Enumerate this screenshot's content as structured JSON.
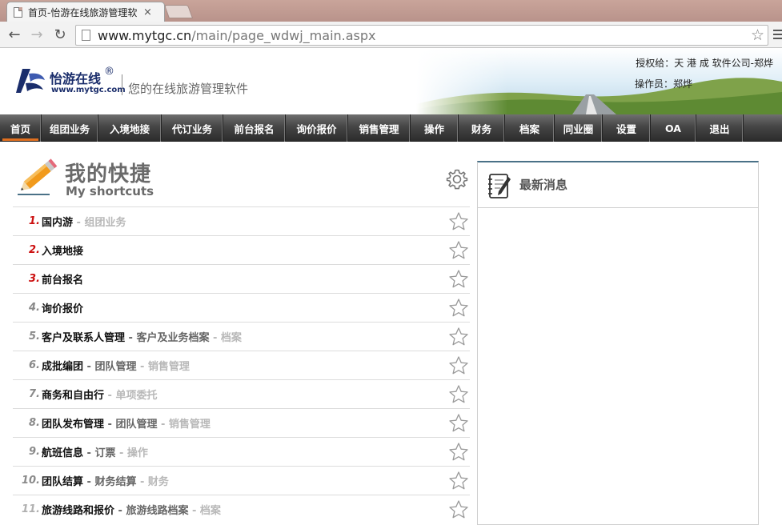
{
  "browser": {
    "tab_title": "首页-怡游在线旅游管理软",
    "tab_close": "×",
    "url_host": "www.mytgc.cn",
    "url_path": "/main/page_wdwj_main.aspx"
  },
  "header": {
    "brand_name": "怡游在线",
    "brand_reg": "®",
    "brand_url": "www.mytgc.com",
    "slogan": "您的在线旅游管理软件",
    "authorized_to": "授权给：天 港 成 软件公司-郑烨",
    "operator": "操作员：郑烨"
  },
  "nav": {
    "items": [
      {
        "label": "首页",
        "active": true
      },
      {
        "label": "组团业务"
      },
      {
        "label": "入境地接"
      },
      {
        "label": "代订业务"
      },
      {
        "label": "前台报名"
      },
      {
        "label": "询价报价"
      },
      {
        "label": "销售管理"
      },
      {
        "label": "操作"
      },
      {
        "label": "财务"
      },
      {
        "label": "档案"
      },
      {
        "label": "同业圈"
      },
      {
        "label": "设置"
      },
      {
        "label": "OA"
      },
      {
        "label": "退出"
      }
    ]
  },
  "shortcuts": {
    "title_cn": "我的快捷",
    "title_en": "My shortcuts",
    "items": [
      {
        "num": "1.",
        "num_color": "red",
        "main": "国内游",
        "mid": "",
        "tail": " - 组团业务"
      },
      {
        "num": "2.",
        "num_color": "red",
        "main": "入境地接",
        "mid": "",
        "tail": ""
      },
      {
        "num": "3.",
        "num_color": "red",
        "main": "前台报名",
        "mid": "",
        "tail": ""
      },
      {
        "num": "4.",
        "num_color": "grey",
        "main": "询价报价",
        "mid": "",
        "tail": ""
      },
      {
        "num": "5.",
        "num_color": "grey",
        "main": "客户及联系人管理",
        "mid": " - 客户及业务档案",
        "tail": " - 档案"
      },
      {
        "num": "6.",
        "num_color": "grey",
        "main": "成批编团",
        "mid": " - 团队管理",
        "tail": " - 销售管理"
      },
      {
        "num": "7.",
        "num_color": "grey",
        "main": "商务和自由行",
        "mid": "",
        "tail": " - 单项委托"
      },
      {
        "num": "8.",
        "num_color": "grey",
        "main": "团队发布管理",
        "mid": " - 团队管理",
        "tail": " - 销售管理"
      },
      {
        "num": "9.",
        "num_color": "grey",
        "main": "航班信息",
        "mid": " - 订票",
        "tail": " - 操作"
      },
      {
        "num": "10.",
        "num_color": "grey",
        "main": "团队结算",
        "mid": " - 财务结算",
        "tail": " - 财务"
      },
      {
        "num": "11.",
        "num_color": "lgrey",
        "main": "旅游线路和报价",
        "mid": " - 旅游线路档案",
        "tail": " - 档案"
      }
    ]
  },
  "news": {
    "title": "最新消息"
  },
  "colors": {
    "accent_orange": "#e07020",
    "nav_dark": "#2c2c2c",
    "news_border": "#4a7187",
    "number_red": "#cc1111"
  }
}
